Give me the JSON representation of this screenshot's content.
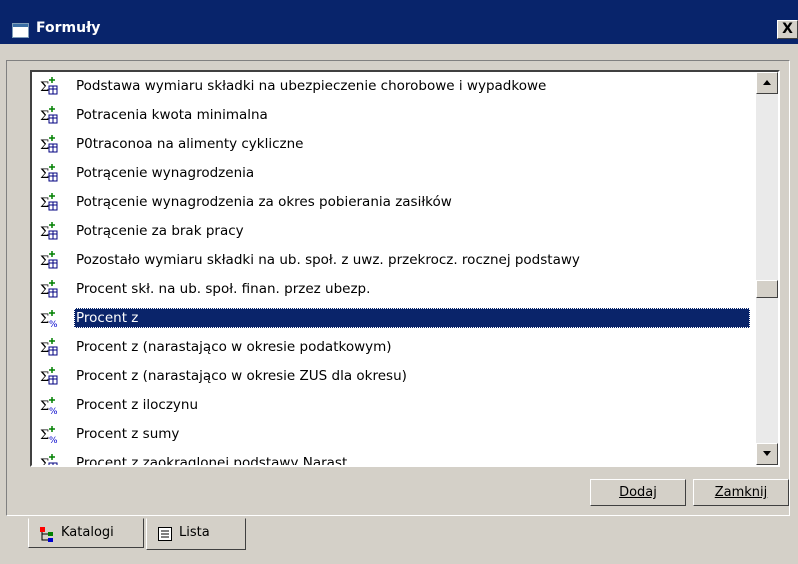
{
  "window": {
    "title": "Formuły",
    "close_label": "X"
  },
  "list": {
    "items": [
      {
        "label": "Podstawa wymiaru składki na ubezpieczenie chorobowe i wypadkowe",
        "icon": "formula-table-icon"
      },
      {
        "label": "Potracenia kwota minimalna",
        "icon": "formula-table-icon"
      },
      {
        "label": "P0traconoa na alimenty cykliczne",
        "icon": "formula-table-icon"
      },
      {
        "label": "Potrącenie wynagrodzenia",
        "icon": "formula-table-icon"
      },
      {
        "label": "Potrącenie wynagrodzenia za okres pobierania zasiłków",
        "icon": "formula-table-icon"
      },
      {
        "label": "Potrącenie za brak pracy",
        "icon": "formula-table-icon"
      },
      {
        "label": "Pozostało wymiaru składki na ub. społ. z uwz. przekrocz. rocznej podstawy",
        "icon": "formula-table-icon"
      },
      {
        "label": "Procent skł. na ub. społ. finan. przez ubezp.",
        "icon": "formula-table-icon"
      },
      {
        "label": "Procent z",
        "icon": "formula-percent-icon",
        "selected": true
      },
      {
        "label": "Procent z (narastająco w okresie podatkowym)",
        "icon": "formula-table-icon"
      },
      {
        "label": "Procent z (narastająco w okresie ZUS dla okresu)",
        "icon": "formula-table-icon"
      },
      {
        "label": "Procent z iloczynu",
        "icon": "formula-percent-icon"
      },
      {
        "label": "Procent z sumy",
        "icon": "formula-percent-icon"
      },
      {
        "label": "Procent z zaokraglonej podstawy Narast",
        "icon": "formula-table-icon"
      }
    ]
  },
  "buttons": {
    "add_label": "Dodaj",
    "close_label": "Zamknij"
  },
  "tabs": [
    {
      "label": "Katalogi",
      "icon": "tree-icon"
    },
    {
      "label": "Lista",
      "icon": "list-icon",
      "active": true
    }
  ],
  "colors": {
    "selection": "#0a246a",
    "titlebar": "#08246b",
    "face": "#d4d0c8"
  }
}
